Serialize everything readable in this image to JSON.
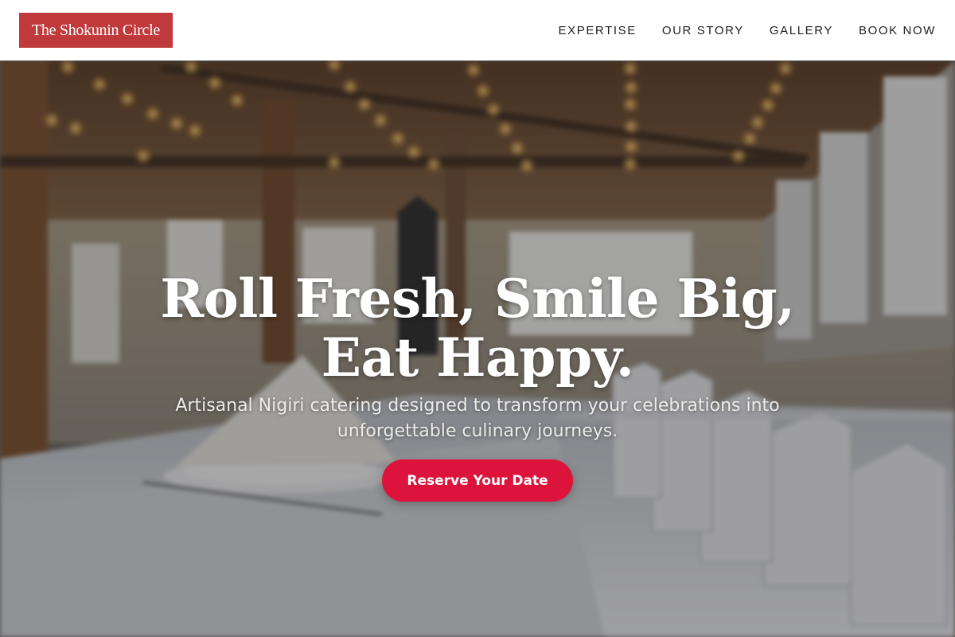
{
  "brand": {
    "name": "The Shokunin Circle"
  },
  "nav": {
    "items": [
      {
        "label": "EXPERTISE"
      },
      {
        "label": "OUR STORY"
      },
      {
        "label": "GALLERY"
      },
      {
        "label": "BOOK NOW"
      }
    ]
  },
  "hero": {
    "headline": "Roll Fresh, Smile Big, Eat Happy.",
    "subheadline": "Artisanal Nigiri catering designed to transform your celebrations into unforgettable culinary journeys.",
    "cta_label": "Reserve Your Date",
    "background_image": "banquet-hall-table-setting-photo"
  },
  "colors": {
    "brand_red": "#c0393b",
    "cta_red": "#dc143c",
    "header_bg": "#ffffff",
    "nav_text": "#1e1e1e"
  }
}
